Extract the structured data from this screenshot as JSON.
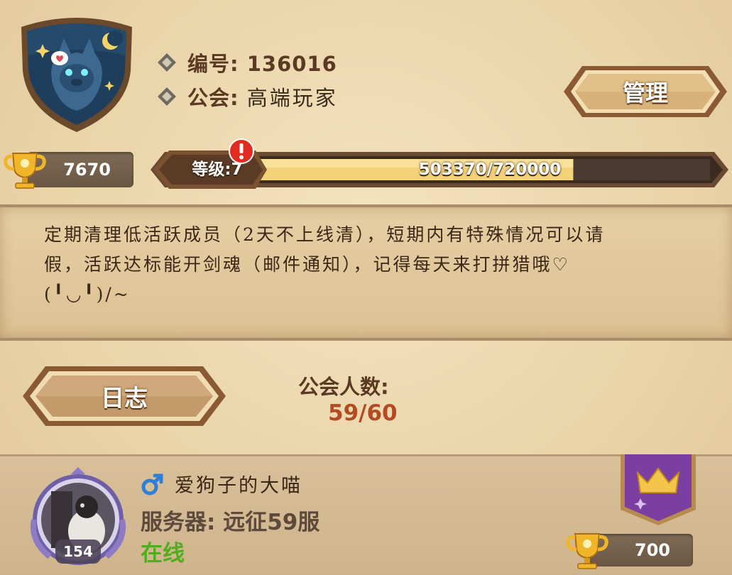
{
  "guild": {
    "id_label": "编号:",
    "id_value": "136016",
    "name_label": "公会:",
    "name_value": "高端玩家",
    "trophies": "7670"
  },
  "buttons": {
    "manage": "管理",
    "log": "日志"
  },
  "level": {
    "label": "等级:7",
    "progress_text": "503370/720000",
    "current": 503370,
    "max": 720000,
    "alert_icon": "exclamation-alert-icon"
  },
  "description": {
    "line1": "定期清理低活跃成员（2天不上线清），短期内有特殊情况可以请",
    "line2": "假，活跃达标能开剑魂（邮件通知），记得每天来打拼猎哦♡",
    "line3": "(╹◡╹)/~"
  },
  "members": {
    "label": "公会人数:",
    "count": "59/60"
  },
  "leader": {
    "gender_icon": "male-icon",
    "name": "爱狗子的大喵",
    "level": "154",
    "server": "服务器: 远征59服",
    "status": "在线",
    "trophies": "700",
    "role_icon": "crown-banner-icon"
  },
  "colors": {
    "progress_fill": "#f3d27a",
    "members_count": "#b34a22",
    "online": "#4fae1d",
    "leader_banner": "#7a3fa1",
    "male_icon": "#2f7fd8"
  }
}
